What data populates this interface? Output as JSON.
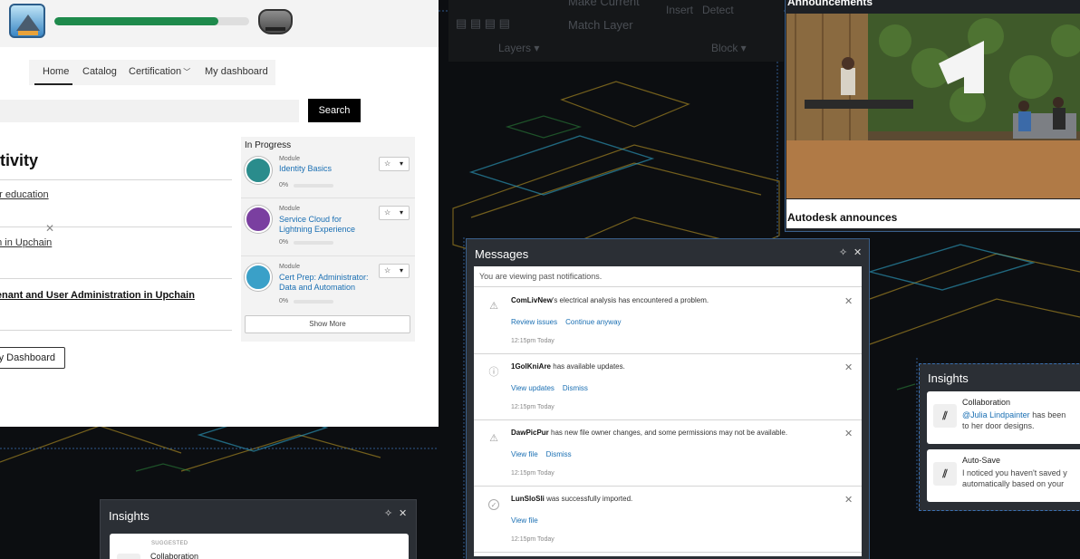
{
  "cad": {
    "toolbar": {
      "make_current": "Make Current",
      "match_layer": "Match Layer",
      "insert": "Insert",
      "detect": "Detect",
      "layers_group": "Layers ▾",
      "block_group": "Block ▾"
    }
  },
  "portal": {
    "progress_percent": 84,
    "nav": {
      "home": "Home",
      "catalog": "Catalog",
      "certification": "Certification",
      "dashboard": "My dashboard"
    },
    "search_label": "Search",
    "activity_title": "ctivity",
    "activity_items": [
      {
        "title": "for education"
      },
      {
        "title": "on in Upchain"
      },
      {
        "title": "Tenant and User Administration in Upchain",
        "sub": "e"
      }
    ],
    "dashboard_button": "y Dashboard",
    "in_progress": {
      "heading": "In Progress",
      "modules": [
        {
          "type": "Module",
          "title": "Identity Basics",
          "pct": "0%",
          "color": "#2a8c8c"
        },
        {
          "type": "Module",
          "title": "Service Cloud for Lightning Experience",
          "pct": "0%",
          "color": "#7a3fa0"
        },
        {
          "type": "Module",
          "title": "Cert Prep: Administrator: Data and Automation",
          "pct": "0%",
          "color": "#3aa0c8"
        }
      ],
      "show_more": "Show More"
    }
  },
  "announcements": {
    "title": "Announcements",
    "caption": "Autodesk announces"
  },
  "messages": {
    "title": "Messages",
    "note": "You are viewing past notifications.",
    "items": [
      {
        "icon": "warning-icon",
        "user": "ComLivNew",
        "text": "'s electrical analysis has encountered a problem.",
        "actions": [
          "Review issues",
          "Continue anyway"
        ],
        "time": "12:15pm Today"
      },
      {
        "icon": "info-icon",
        "user": "1GolKniAre",
        "text": " has available updates.",
        "actions": [
          "View updates",
          "Dismiss"
        ],
        "time": "12:15pm Today"
      },
      {
        "icon": "warning-icon",
        "user": "DawPicPur",
        "text": " has new file owner changes, and some permissions may not be available.",
        "actions": [
          "View file",
          "Dismiss"
        ],
        "time": "12:15pm Today"
      },
      {
        "icon": "check-icon",
        "user": "LunSloSli",
        "text": " was successfully imported.",
        "actions": [
          "View file"
        ],
        "time": "12:15pm Today"
      }
    ]
  },
  "insights_right": {
    "title": "Insights",
    "cards": [
      {
        "heading": "Collaboration",
        "mention": "@Julia Lindpainter",
        "line1": " has been",
        "line2": "to her door designs."
      },
      {
        "heading": "Auto-Save",
        "line1": "I noticed you haven't saved y",
        "line2": "automatically based on your"
      }
    ]
  },
  "insights_left": {
    "title": "Insights",
    "suggested": "SUGGESTED",
    "heading": "Collaboration"
  },
  "colors": {
    "accent_blue": "#1a6fb3",
    "progress_green": "#1e8a4c",
    "panel_dark": "#2b2f35"
  }
}
